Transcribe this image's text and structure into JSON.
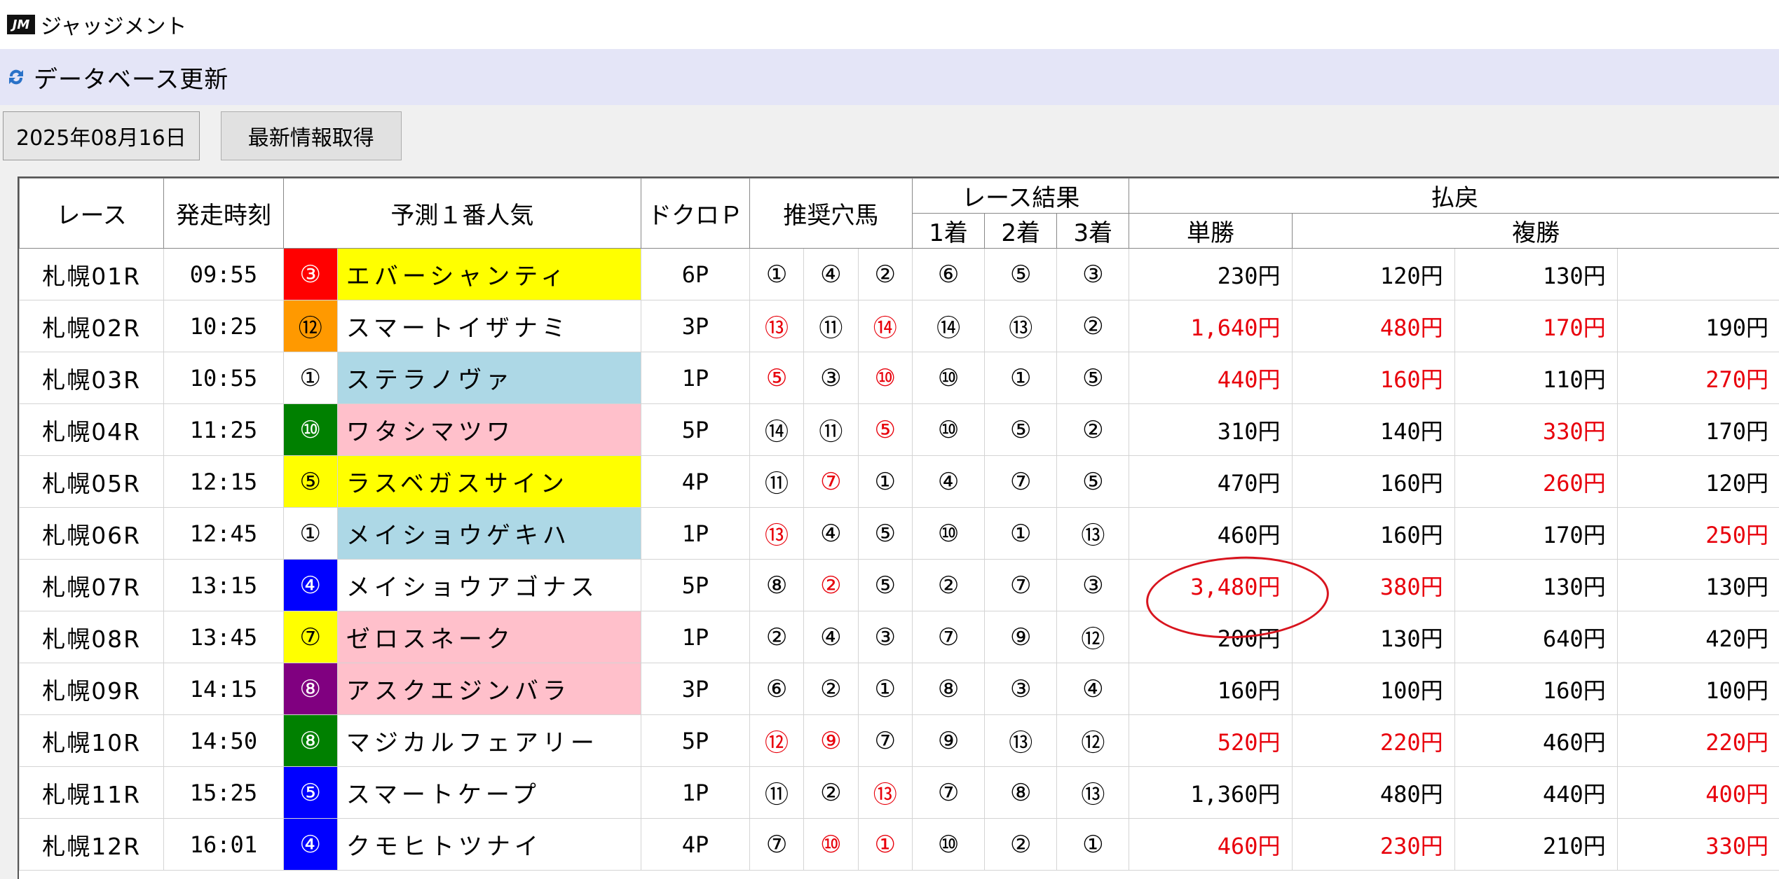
{
  "app": {
    "logo": "JM",
    "title": "ジャッジメント"
  },
  "section": {
    "title": "データベース更新"
  },
  "toolbar": {
    "date": "2025年08月16日",
    "fetch_label": "最新情報取得"
  },
  "table": {
    "headers": {
      "race": "レース",
      "start_time": "発走時刻",
      "favorite": "予測１番人気",
      "dokuro": "ドクロＰ",
      "recommended": "推奨穴馬",
      "result": "レース結果",
      "first": "1着",
      "second": "2着",
      "third": "3着",
      "payout": "払戻",
      "win": "単勝",
      "place": "複勝"
    },
    "colors": {
      "yellow": "#ffff00",
      "pink": "#ffc0cb",
      "lightblue": "#add8e6",
      "red": "#ff0000",
      "orange": "#ff9900",
      "green": "#008000",
      "blue": "#0000ff",
      "purple": "#800080",
      "white": "#ffffff"
    },
    "rows": [
      {
        "race": "札幌01R",
        "time": "09:55",
        "fav_num": "③",
        "fav_num_bg": "#ff0000",
        "fav_num_fg": "#ffffff",
        "fav_name": "エバーシャンティ",
        "fav_name_bg": "#ffff00",
        "dokuro": "6P",
        "rec": [
          {
            "v": "①",
            "red": false
          },
          {
            "v": "④",
            "red": false
          },
          {
            "v": "②",
            "red": false
          }
        ],
        "res": [
          "⑥",
          "⑤",
          "③"
        ],
        "win": {
          "v": "230円",
          "red": false
        },
        "place": [
          {
            "v": "120円",
            "red": false
          },
          {
            "v": "130円",
            "red": false
          },
          {
            "v": "",
            "red": false
          }
        ]
      },
      {
        "race": "札幌02R",
        "time": "10:25",
        "fav_num": "⑫",
        "fav_num_bg": "#ff9900",
        "fav_num_fg": "#000000",
        "fav_name": "スマートイザナミ",
        "fav_name_bg": "#ffffff",
        "dokuro": "3P",
        "rec": [
          {
            "v": "⑬",
            "red": true
          },
          {
            "v": "⑪",
            "red": false
          },
          {
            "v": "⑭",
            "red": true
          }
        ],
        "res": [
          "⑭",
          "⑬",
          "②"
        ],
        "win": {
          "v": "1,640円",
          "red": true
        },
        "place": [
          {
            "v": "480円",
            "red": true
          },
          {
            "v": "170円",
            "red": true
          },
          {
            "v": "190円",
            "red": false
          }
        ]
      },
      {
        "race": "札幌03R",
        "time": "10:55",
        "fav_num": "①",
        "fav_num_bg": "#ffffff",
        "fav_num_fg": "#000000",
        "fav_name": "ステラノヴァ",
        "fav_name_bg": "#add8e6",
        "dokuro": "1P",
        "rec": [
          {
            "v": "⑤",
            "red": true
          },
          {
            "v": "③",
            "red": false
          },
          {
            "v": "⑩",
            "red": true
          }
        ],
        "res": [
          "⑩",
          "①",
          "⑤"
        ],
        "win": {
          "v": "440円",
          "red": true
        },
        "place": [
          {
            "v": "160円",
            "red": true
          },
          {
            "v": "110円",
            "red": false
          },
          {
            "v": "270円",
            "red": true
          }
        ]
      },
      {
        "race": "札幌04R",
        "time": "11:25",
        "fav_num": "⑩",
        "fav_num_bg": "#008000",
        "fav_num_fg": "#ffffff",
        "fav_name": "ワタシマツワ",
        "fav_name_bg": "#ffc0cb",
        "dokuro": "5P",
        "rec": [
          {
            "v": "⑭",
            "red": false
          },
          {
            "v": "⑪",
            "red": false
          },
          {
            "v": "⑤",
            "red": true
          }
        ],
        "res": [
          "⑩",
          "⑤",
          "②"
        ],
        "win": {
          "v": "310円",
          "red": false
        },
        "place": [
          {
            "v": "140円",
            "red": false
          },
          {
            "v": "330円",
            "red": true
          },
          {
            "v": "170円",
            "red": false
          }
        ]
      },
      {
        "race": "札幌05R",
        "time": "12:15",
        "fav_num": "⑤",
        "fav_num_bg": "#ffff00",
        "fav_num_fg": "#000000",
        "fav_name": "ラスベガスサイン",
        "fav_name_bg": "#ffff00",
        "dokuro": "4P",
        "rec": [
          {
            "v": "⑪",
            "red": false
          },
          {
            "v": "⑦",
            "red": true
          },
          {
            "v": "①",
            "red": false
          }
        ],
        "res": [
          "④",
          "⑦",
          "⑤"
        ],
        "win": {
          "v": "470円",
          "red": false
        },
        "place": [
          {
            "v": "160円",
            "red": false
          },
          {
            "v": "260円",
            "red": true
          },
          {
            "v": "120円",
            "red": false
          }
        ]
      },
      {
        "race": "札幌06R",
        "time": "12:45",
        "fav_num": "①",
        "fav_num_bg": "#ffffff",
        "fav_num_fg": "#000000",
        "fav_name": "メイショウゲキハ",
        "fav_name_bg": "#add8e6",
        "dokuro": "1P",
        "rec": [
          {
            "v": "⑬",
            "red": true
          },
          {
            "v": "④",
            "red": false
          },
          {
            "v": "⑤",
            "red": false
          }
        ],
        "res": [
          "⑩",
          "①",
          "⑬"
        ],
        "win": {
          "v": "460円",
          "red": false
        },
        "place": [
          {
            "v": "160円",
            "red": false
          },
          {
            "v": "170円",
            "red": false
          },
          {
            "v": "250円",
            "red": true
          }
        ]
      },
      {
        "race": "札幌07R",
        "time": "13:15",
        "fav_num": "④",
        "fav_num_bg": "#0000ff",
        "fav_num_fg": "#ffffff",
        "fav_name": "メイショウアゴナス",
        "fav_name_bg": "#ffffff",
        "dokuro": "5P",
        "rec": [
          {
            "v": "⑧",
            "red": false
          },
          {
            "v": "②",
            "red": true
          },
          {
            "v": "⑤",
            "red": false
          }
        ],
        "res": [
          "②",
          "⑦",
          "③"
        ],
        "win": {
          "v": "3,480円",
          "red": true
        },
        "place": [
          {
            "v": "380円",
            "red": true
          },
          {
            "v": "130円",
            "red": false
          },
          {
            "v": "130円",
            "red": false
          }
        ]
      },
      {
        "race": "札幌08R",
        "time": "13:45",
        "fav_num": "⑦",
        "fav_num_bg": "#ffff00",
        "fav_num_fg": "#000000",
        "fav_name": "ゼロスネーク",
        "fav_name_bg": "#ffc0cb",
        "dokuro": "1P",
        "rec": [
          {
            "v": "②",
            "red": false
          },
          {
            "v": "④",
            "red": false
          },
          {
            "v": "③",
            "red": false
          }
        ],
        "res": [
          "⑦",
          "⑨",
          "⑫"
        ],
        "win": {
          "v": "200円",
          "red": false
        },
        "place": [
          {
            "v": "130円",
            "red": false
          },
          {
            "v": "640円",
            "red": false
          },
          {
            "v": "420円",
            "red": false
          }
        ]
      },
      {
        "race": "札幌09R",
        "time": "14:15",
        "fav_num": "⑧",
        "fav_num_bg": "#800080",
        "fav_num_fg": "#ffffff",
        "fav_name": "アスクエジンバラ",
        "fav_name_bg": "#ffc0cb",
        "dokuro": "3P",
        "rec": [
          {
            "v": "⑥",
            "red": false
          },
          {
            "v": "②",
            "red": false
          },
          {
            "v": "①",
            "red": false
          }
        ],
        "res": [
          "⑧",
          "③",
          "④"
        ],
        "win": {
          "v": "160円",
          "red": false
        },
        "place": [
          {
            "v": "100円",
            "red": false
          },
          {
            "v": "160円",
            "red": false
          },
          {
            "v": "100円",
            "red": false
          }
        ]
      },
      {
        "race": "札幌10R",
        "time": "14:50",
        "fav_num": "⑧",
        "fav_num_bg": "#008000",
        "fav_num_fg": "#ffffff",
        "fav_name": "マジカルフェアリー",
        "fav_name_bg": "#ffffff",
        "dokuro": "5P",
        "rec": [
          {
            "v": "⑫",
            "red": true
          },
          {
            "v": "⑨",
            "red": true
          },
          {
            "v": "⑦",
            "red": false
          }
        ],
        "res": [
          "⑨",
          "⑬",
          "⑫"
        ],
        "win": {
          "v": "520円",
          "red": true
        },
        "place": [
          {
            "v": "220円",
            "red": true
          },
          {
            "v": "460円",
            "red": false
          },
          {
            "v": "220円",
            "red": true
          }
        ]
      },
      {
        "race": "札幌11R",
        "time": "15:25",
        "fav_num": "⑤",
        "fav_num_bg": "#0000ff",
        "fav_num_fg": "#ffffff",
        "fav_name": "スマートケープ",
        "fav_name_bg": "#ffffff",
        "dokuro": "1P",
        "rec": [
          {
            "v": "⑪",
            "red": false
          },
          {
            "v": "②",
            "red": false
          },
          {
            "v": "⑬",
            "red": true
          }
        ],
        "res": [
          "⑦",
          "⑧",
          "⑬"
        ],
        "win": {
          "v": "1,360円",
          "red": false
        },
        "place": [
          {
            "v": "480円",
            "red": false
          },
          {
            "v": "440円",
            "red": false
          },
          {
            "v": "400円",
            "red": true
          }
        ]
      },
      {
        "race": "札幌12R",
        "time": "16:01",
        "fav_num": "④",
        "fav_num_bg": "#0000ff",
        "fav_num_fg": "#ffffff",
        "fav_name": "クモヒトツナイ",
        "fav_name_bg": "#ffffff",
        "dokuro": "4P",
        "rec": [
          {
            "v": "⑦",
            "red": false
          },
          {
            "v": "⑩",
            "red": true
          },
          {
            "v": "①",
            "red": true
          }
        ],
        "res": [
          "⑩",
          "②",
          "①"
        ],
        "win": {
          "v": "460円",
          "red": true
        },
        "place": [
          {
            "v": "230円",
            "red": true
          },
          {
            "v": "210円",
            "red": false
          },
          {
            "v": "330円",
            "red": true
          }
        ]
      }
    ]
  }
}
